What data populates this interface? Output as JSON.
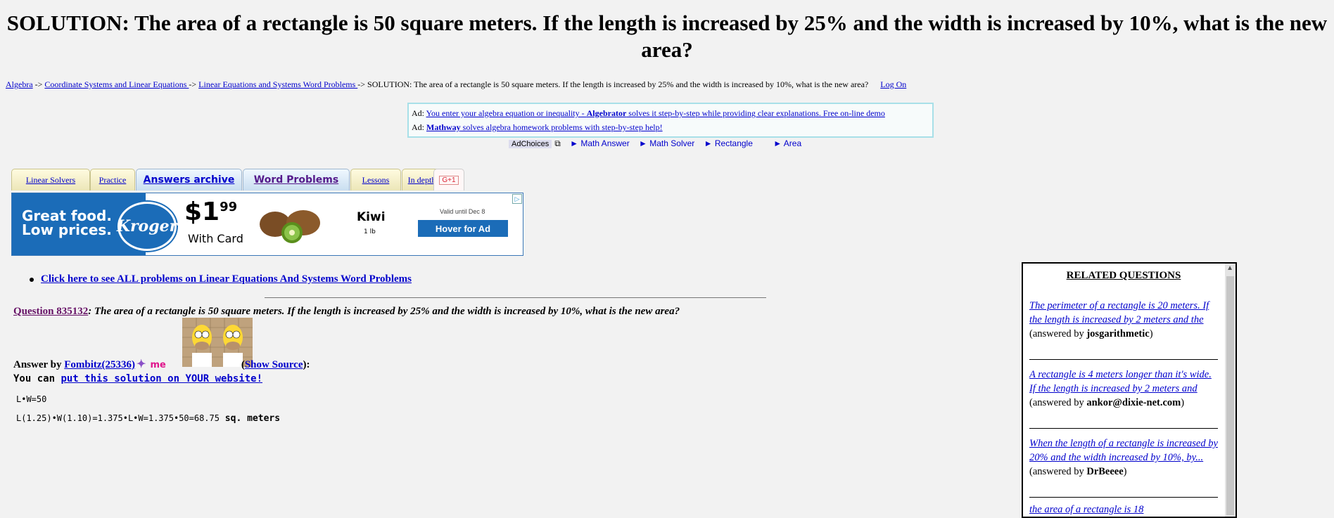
{
  "title": "SOLUTION: The area of a rectangle is 50 square meters. If the length is increased by 25% and the width is increased by 10%, what is the new area?",
  "breadcrumb": {
    "item1": "Algebra",
    "sep": " -> ",
    "item2": "Coordinate Systems and Linear Equations ",
    "item3": "Linear Equations and Systems Word Problems ",
    "current": " -> SOLUTION: The area of a rectangle is 50 square meters. If the length is increased by 25% and the width is increased by 10%, what is the new area?",
    "login": "Log On"
  },
  "ads": {
    "prefix": "Ad: ",
    "ad1_pre": "You enter your algebra equation or inequality - ",
    "ad1_bold": "Algebrator",
    "ad1_post": " solves it step-by-step while providing clear explanations. Free on-line demo",
    "ad2_bold": "Mathway",
    "ad2_post": " solves algebra homework problems with step-by-step help!"
  },
  "adbar": {
    "adchoices": "AdChoices",
    "links": [
      "► Math Answer",
      "► Math Solver",
      "► Rectangle",
      "► Area"
    ]
  },
  "tabs": [
    "Linear Solvers",
    "Practice",
    "Answers archive",
    "Word Problems",
    "Lessons",
    "In depth",
    "G+1"
  ],
  "banner": {
    "slogan1": "Great food.",
    "slogan2": "Low prices.",
    "logo": "Kroger",
    "price_dollar": "$1",
    "price_cents": "99",
    "with_card": "With Card",
    "product": "Kiwi",
    "weight": "1 lb",
    "valid": "Valid until Dec 8",
    "cta": "Hover for Ad",
    "ad_icon": "▷"
  },
  "all_problems_link": "Click here to see ALL problems on Linear Equations And Systems Word Problems",
  "question": {
    "id_label": "Question 835132",
    "text": ": The area of a rectangle is 50 square meters. If the length is increased by 25% and the width is increased by 10%, what is the new area?"
  },
  "answer": {
    "prefix": "Answer by ",
    "author": "Fombitz(25336)",
    "me": "me",
    "show_source": "Show Source",
    "you_can": "You can ",
    "put_solution": "put this solution on YOUR website!",
    "paren_open": "(",
    "paren_close": "):"
  },
  "math": {
    "line1": "L•W=50",
    "line2": "L(1.25)•W(1.10)=1.375•L•W=1.375•50=68.75",
    "line2_unit": " sq. meters"
  },
  "related": {
    "title": "RELATED QUESTIONS",
    "items": [
      {
        "link": "The perimeter of a rectangle is 20 meters. If the length is increased by 2 meters and the ",
        "answered": "(answered by ",
        "by": "josgarithmetic",
        "close": ")"
      },
      {
        "link": "A rectangle is 4 meters longer than it's wide. If the length is increased by 2 meters and ",
        "answered": "(answered by ",
        "by": "ankor@dixie-net.com",
        "close": ")"
      },
      {
        "link": "When the length of a rectangle is increased by 20% and the width increased by 10%, by... ",
        "answered": "(answered by ",
        "by": "DrBeeee",
        "close": ")"
      },
      {
        "link": "the area of a rectangle is 18",
        "answered": "",
        "by": "",
        "close": ""
      }
    ]
  }
}
